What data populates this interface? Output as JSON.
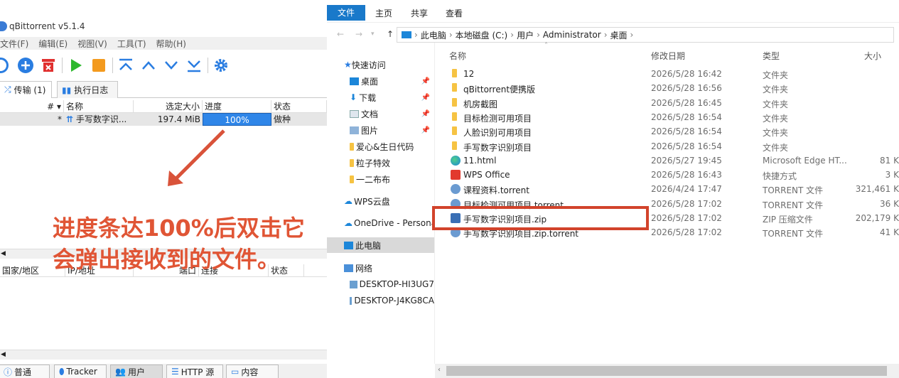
{
  "qbt": {
    "title": "qBittorrent v5.1.4",
    "menu": [
      "文件(F)",
      "编辑(E)",
      "视图(V)",
      "工具(T)",
      "帮助(H)"
    ],
    "tabs": {
      "transfers": "传输 (1)",
      "log": "执行日志"
    },
    "columns": [
      "#",
      "名称",
      "选定大小",
      "进度",
      "状态"
    ],
    "torrent": {
      "num": "*",
      "name": "手写数字识...",
      "size": "197.4 MiB",
      "progress": "100%",
      "progress_value": 1.0,
      "status": "做种"
    },
    "peer_columns": [
      "国家/地区",
      "IP/地址",
      "端口",
      "连接",
      "状态"
    ],
    "bottom_tabs": [
      "普通",
      "Tracker",
      "用户",
      "HTTP 源",
      "内容"
    ]
  },
  "annotation": {
    "line1": "进度条达100%后双击它",
    "line2": "会弹出接收到的文件。"
  },
  "explorer": {
    "ribbon_tabs": [
      "文件",
      "主页",
      "共享",
      "查看"
    ],
    "breadcrumb": [
      "此电脑",
      "本地磁盘 (C:)",
      "用户",
      "Administrator",
      "桌面"
    ],
    "columns": {
      "name": "名称",
      "date": "修改日期",
      "type": "类型",
      "size": "大小"
    },
    "nav": [
      {
        "label": "快速访问"
      },
      {
        "label": "桌面",
        "pinned": true
      },
      {
        "label": "下载",
        "pinned": true
      },
      {
        "label": "文档",
        "pinned": true
      },
      {
        "label": "图片",
        "pinned": true
      },
      {
        "label": "爱心&生日代码"
      },
      {
        "label": "粒子特效"
      },
      {
        "label": "一二布布"
      },
      {
        "label": "WPS云盘"
      },
      {
        "label": "OneDrive - Personal"
      },
      {
        "label": "此电脑"
      },
      {
        "label": "网络"
      },
      {
        "label": "DESKTOP-HI3UG7"
      },
      {
        "label": "DESKTOP-J4KG8CA"
      }
    ],
    "files": [
      {
        "name": "12",
        "date": "2026/5/28 16:42",
        "type": "文件夹",
        "size": "",
        "icon": "folder-icon"
      },
      {
        "name": "qBittorrent便携版",
        "date": "2026/5/28 16:56",
        "type": "文件夹",
        "size": "",
        "icon": "folder-icon"
      },
      {
        "name": "机房截图",
        "date": "2026/5/28 16:45",
        "type": "文件夹",
        "size": "",
        "icon": "folder-icon"
      },
      {
        "name": "目标检测可用项目",
        "date": "2026/5/28 16:54",
        "type": "文件夹",
        "size": "",
        "icon": "folder-icon"
      },
      {
        "name": "人脸识别可用项目",
        "date": "2026/5/28 16:54",
        "type": "文件夹",
        "size": "",
        "icon": "folder-icon"
      },
      {
        "name": "手写数字识别项目",
        "date": "2026/5/28 16:54",
        "type": "文件夹",
        "size": "",
        "icon": "folder-icon"
      },
      {
        "name": "11.html",
        "date": "2026/5/27 19:45",
        "type": "Microsoft Edge HT...",
        "size": "81 K",
        "icon": "edge-icon"
      },
      {
        "name": "WPS Office",
        "date": "2026/5/28 16:43",
        "type": "快捷方式",
        "size": "3 K",
        "icon": "wps-icon"
      },
      {
        "name": "课程资料.torrent",
        "date": "2026/4/24 17:47",
        "type": "TORRENT 文件",
        "size": "321,461 K",
        "icon": "torrent-icon"
      },
      {
        "name": "目标检测可用项目.torrent",
        "date": "2026/5/28 17:02",
        "type": "TORRENT 文件",
        "size": "36 K",
        "icon": "torrent-icon"
      },
      {
        "name": "手写数字识别项目.zip",
        "date": "2026/5/28 17:02",
        "type": "ZIP 压缩文件",
        "size": "202,179 K",
        "icon": "zip-icon"
      },
      {
        "name": "手写数字识别项目.zip.torrent",
        "date": "2026/5/28 17:02",
        "type": "TORRENT 文件",
        "size": "41 K",
        "icon": "torrent-icon"
      }
    ]
  }
}
